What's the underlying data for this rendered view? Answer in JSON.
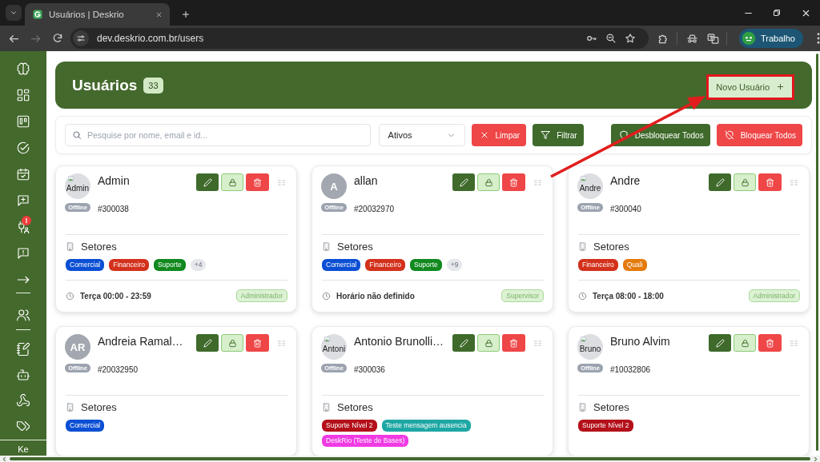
{
  "browser": {
    "tab_title": "Usuários | Deskrio",
    "url": "dev.deskrio.com.br/users",
    "profile_name": "Trabalho"
  },
  "sidebar": {
    "alert_badge": "!",
    "footer_label": "Ke"
  },
  "header": {
    "title": "Usuários",
    "count": "33",
    "new_button": "Novo Usuário"
  },
  "filters": {
    "search_placeholder": "Pesquise por nome, email e id...",
    "status_select": "Ativos",
    "buttons": [
      {
        "label": "Limpar",
        "kind": "clear"
      },
      {
        "label": "Filtrar",
        "kind": "filter"
      }
    ],
    "bulk_buttons": [
      {
        "label": "Desbloquear Todos",
        "kind": "unblock"
      },
      {
        "label": "Bloquear Todos",
        "kind": "block"
      }
    ]
  },
  "users": [
    {
      "name": "Admin",
      "avatar": {
        "kind": "image",
        "text": "Admin"
      },
      "status": "Offline",
      "id": "#300038",
      "sectors_label": "Setores",
      "sectors": [
        {
          "name": "Comercial",
          "color": "#0b4fd4"
        },
        {
          "name": "Financeiro",
          "color": "#d3311c"
        },
        {
          "name": "Suporte",
          "color": "#11891f"
        }
      ],
      "more": "+4",
      "schedule": "Terça 00:00 - 23:59",
      "role": "Administrador"
    },
    {
      "name": "allan",
      "avatar": {
        "kind": "initials",
        "text": "A"
      },
      "status": "Offline",
      "id": "#20032970",
      "sectors_label": "Setores",
      "sectors": [
        {
          "name": "Comercial",
          "color": "#0b4fd4"
        },
        {
          "name": "Financeiro",
          "color": "#d3311c"
        },
        {
          "name": "Suporte",
          "color": "#11891f"
        }
      ],
      "more": "+9",
      "schedule": "Horário não definido",
      "role": "Supervisor"
    },
    {
      "name": "Andre",
      "avatar": {
        "kind": "image",
        "text": "Andre"
      },
      "status": "Offline",
      "id": "#300040",
      "sectors_label": "Setores",
      "sectors": [
        {
          "name": "Financeiro",
          "color": "#d3311c"
        },
        {
          "name": "Quali",
          "color": "#e57a0c"
        }
      ],
      "schedule": "Terça 08:00 - 18:00",
      "role": "Administrador"
    },
    {
      "name": "Andreia Ramal…",
      "avatar": {
        "kind": "initials",
        "text": "AR"
      },
      "status": "Offline",
      "id": "#20032950",
      "sectors_label": "Setores",
      "sectors": [
        {
          "name": "Comercial",
          "color": "#0b4fd4"
        }
      ]
    },
    {
      "name": "Antonio Brunolli…",
      "avatar": {
        "kind": "image",
        "text": "Antoni"
      },
      "status": "Offline",
      "id": "#300036",
      "sectors_label": "Setores",
      "sectors": [
        {
          "name": "Suporte Nível 2",
          "color": "#b3101a"
        },
        {
          "name": "Teste mensagem ausencia",
          "color": "#1ea7a4"
        },
        {
          "name": "DeskRio (Teste de Bases)",
          "color": "#f03ae4"
        }
      ]
    },
    {
      "name": "Bruno Alvim",
      "avatar": {
        "kind": "image",
        "text": "Bruno"
      },
      "status": "Offline",
      "id": "#10032806",
      "sectors_label": "Setores",
      "sectors": [
        {
          "name": "Suporte Nível 2",
          "color": "#b3101a"
        }
      ]
    }
  ]
}
